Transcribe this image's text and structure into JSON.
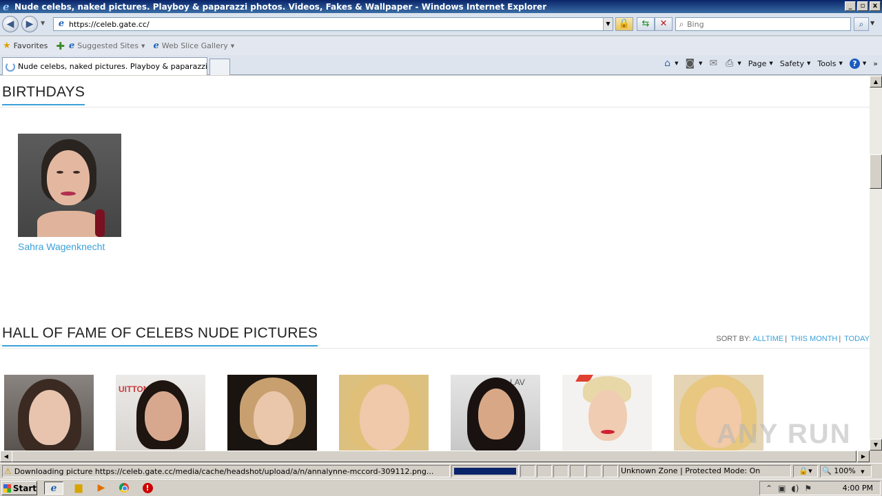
{
  "window": {
    "title": "Nude celebs, naked pictures. Playboy & paparazzi photos. Videos, Fakes & Wallpaper - Windows Internet Explorer",
    "controls": {
      "minimize": "_",
      "maximize": "▫",
      "close": "x"
    }
  },
  "address_bar": {
    "url": "https://celeb.gate.cc/",
    "search_placeholder": "Bing"
  },
  "favorites_bar": {
    "favorites_label": "Favorites",
    "items": [
      {
        "label": "Suggested Sites"
      },
      {
        "label": "Web Slice Gallery"
      }
    ]
  },
  "tabs": {
    "active_label": "Nude celebs, naked pictures. Playboy & paparazzi ph..."
  },
  "command_bar": {
    "page_label": "Page",
    "safety_label": "Safety",
    "tools_label": "Tools"
  },
  "content": {
    "birthdays_title": "BIRTHDAYS",
    "birthday_name": "Sahra Wagenknecht",
    "hof_title": "HALL OF FAME OF CELEBS NUDE PICTURES",
    "sort_by_label": "SORT BY:",
    "sort_options": [
      "ALLTIME",
      "THIS MONTH",
      "TODAY"
    ]
  },
  "status_bar": {
    "status_text": "Downloading picture https://celeb.gate.cc/media/cache/headshot/upload/a/n/annalynne-mccord-309112.png...",
    "zone_text": "Unknown Zone | Protected Mode: On",
    "zoom": "100%"
  },
  "taskbar": {
    "start_label": "Start",
    "clock": "4:00 PM"
  },
  "watermark": "ANY RUN",
  "colors": {
    "accent": "#3aa0d8",
    "title_bar": "#0a246a"
  }
}
